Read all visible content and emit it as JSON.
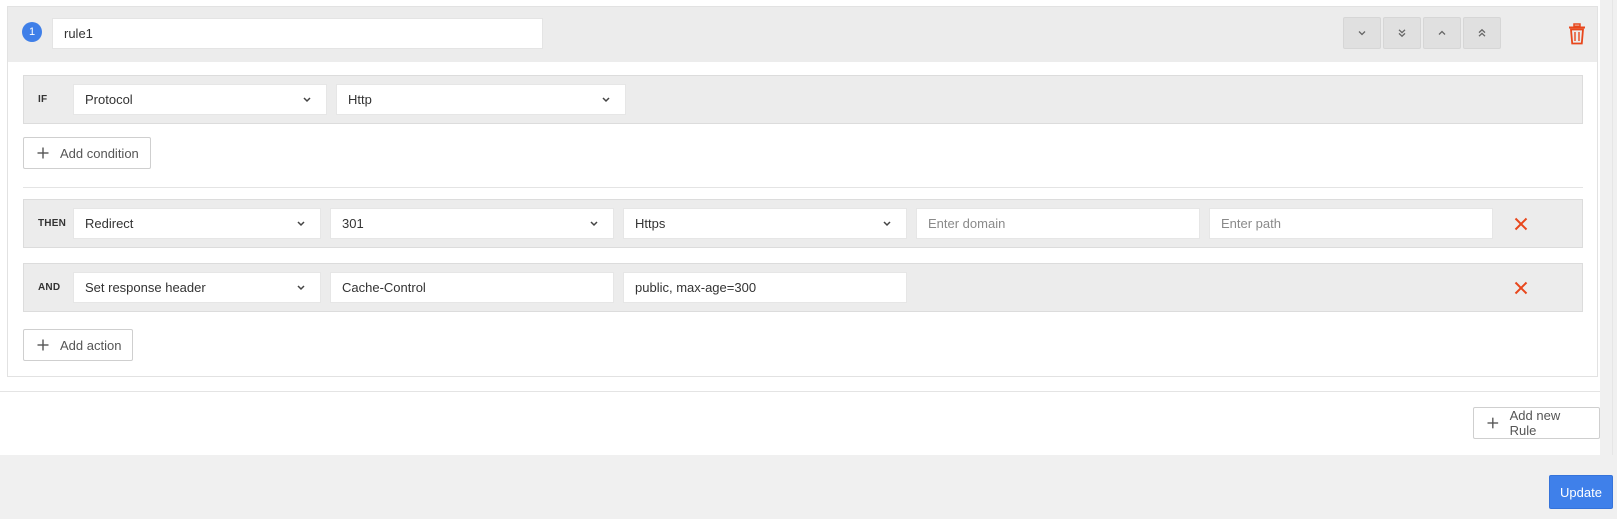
{
  "rule": {
    "number": "1",
    "name": "rule1"
  },
  "move_buttons": [
    {
      "name": "move-down-button",
      "icon": "chevron-down-icon"
    },
    {
      "name": "move-to-bottom-button",
      "icon": "double-chevron-down-icon"
    },
    {
      "name": "move-up-button",
      "icon": "chevron-up-icon"
    },
    {
      "name": "move-to-top-button",
      "icon": "double-chevron-up-icon"
    }
  ],
  "condition": {
    "keyword": "IF",
    "field": "Protocol",
    "value": "Http"
  },
  "add_condition_label": "Add condition",
  "action_then": {
    "keyword": "THEN",
    "action": "Redirect",
    "status_code": "301",
    "protocol": "Https",
    "domain_placeholder": "Enter domain",
    "path_placeholder": "Enter path"
  },
  "action_and": {
    "keyword": "AND",
    "action": "Set response header",
    "header_name": "Cache-Control",
    "header_value": "public, max-age=300"
  },
  "add_action_label": "Add action",
  "add_rule_label": "Add new Rule",
  "update_label": "Update",
  "colors": {
    "accent": "#3f80ea",
    "danger": "#e8471c",
    "panel": "#ececec"
  }
}
